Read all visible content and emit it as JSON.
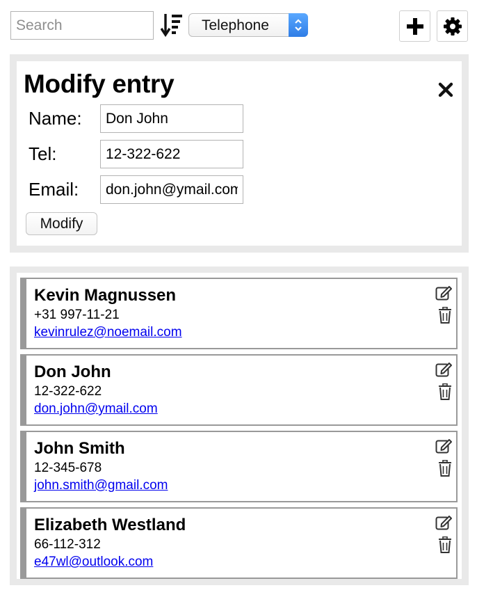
{
  "toolbar": {
    "search_placeholder": "Search",
    "search_value": "",
    "sort_icon": "sort-descending-icon",
    "sort_field": "Telephone",
    "add_icon": "plus-icon",
    "settings_icon": "gear-icon"
  },
  "modify_form": {
    "title": "Modify entry",
    "close_icon": "close-icon",
    "name_label": "Name:",
    "name_value": "Don John",
    "tel_label": "Tel:",
    "tel_value": "12-322-622",
    "email_label": "Email:",
    "email_value": "don.john@ymail.com",
    "submit_label": "Modify"
  },
  "contacts": [
    {
      "name": "Kevin Magnussen",
      "tel": "+31 997-11-21",
      "email": "kevinrulez@noemail.com"
    },
    {
      "name": "Don John",
      "tel": "12-322-622",
      "email": "don.john@ymail.com"
    },
    {
      "name": "John Smith",
      "tel": "12-345-678",
      "email": "john.smith@gmail.com"
    },
    {
      "name": "Elizabeth Westland",
      "tel": "66-112-312",
      "email": "e47wl@outlook.com"
    }
  ],
  "colors": {
    "panel_bg": "#e9e9e9",
    "card_border": "#999999",
    "link": "#0000ee",
    "select_accent": "#2f7de6"
  }
}
